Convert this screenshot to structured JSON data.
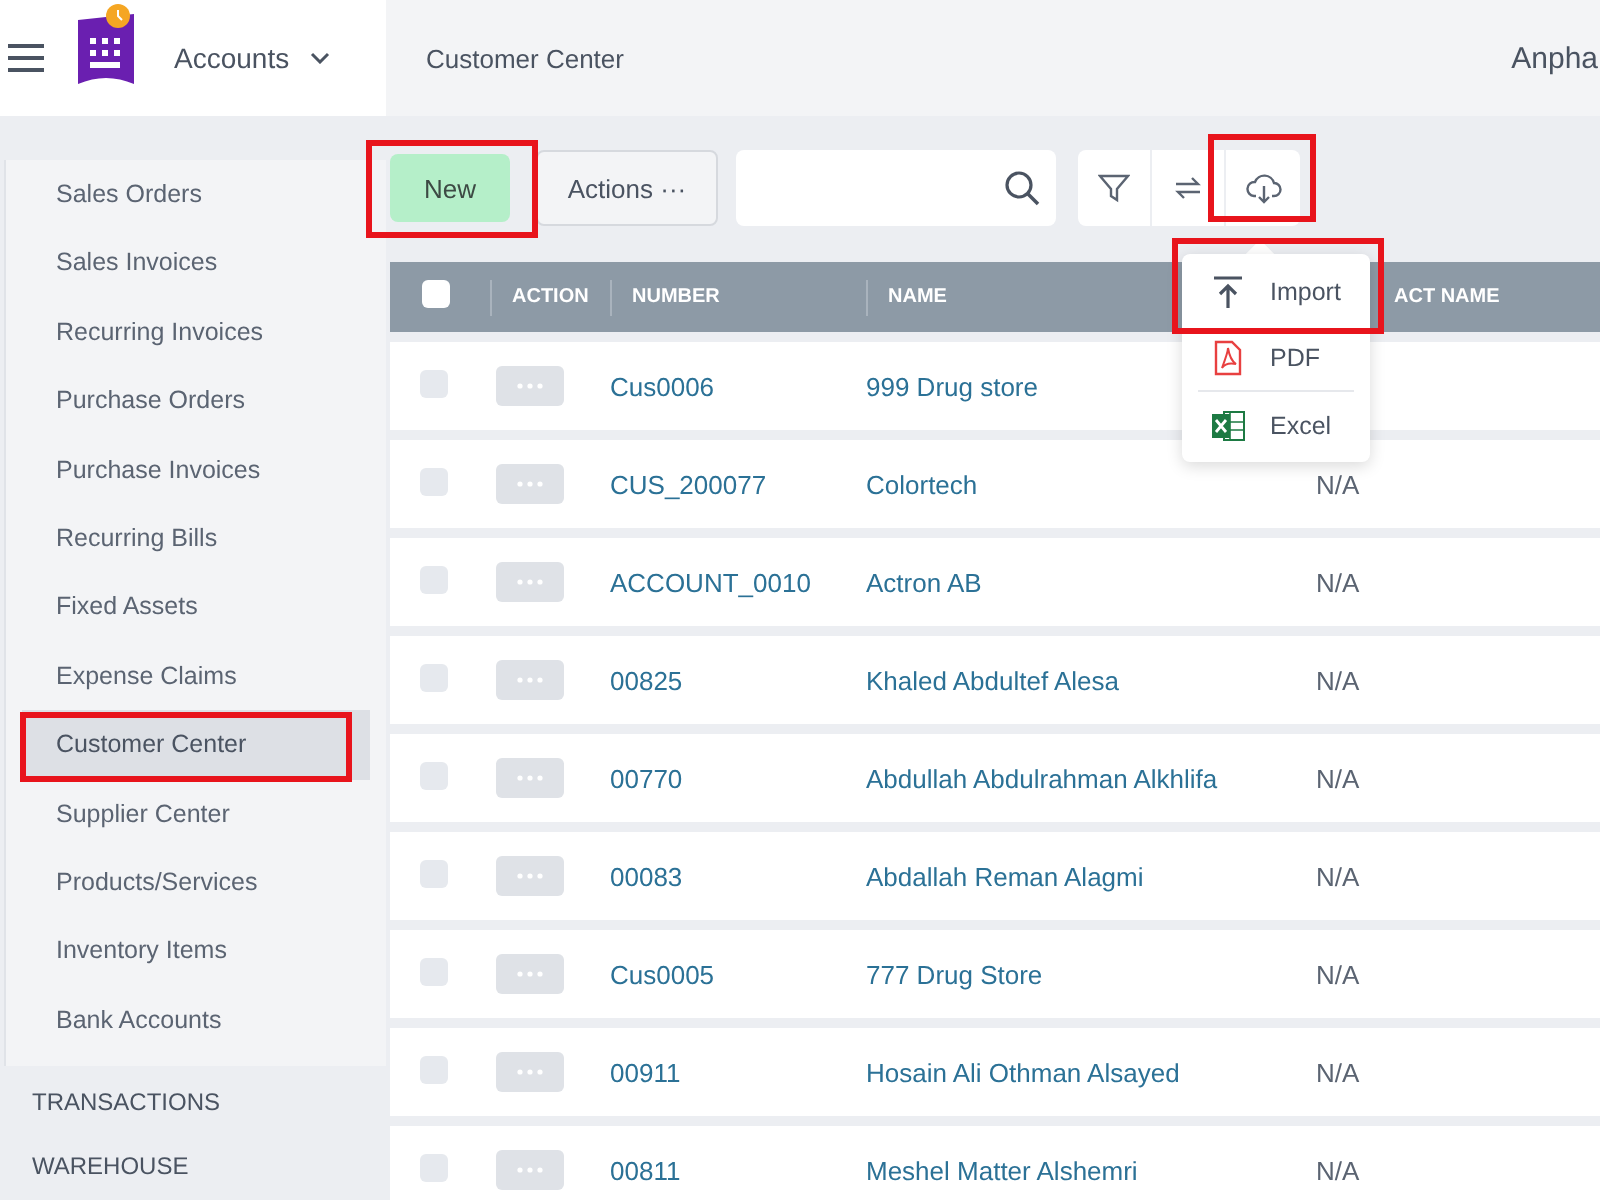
{
  "app": {
    "module": "Accounts",
    "page_title": "Customer Center",
    "company": "Anpha"
  },
  "sidebar": {
    "items": [
      {
        "label": "Sales Orders",
        "selected": false
      },
      {
        "label": "Sales Invoices",
        "selected": false
      },
      {
        "label": "Recurring Invoices",
        "selected": false
      },
      {
        "label": "Purchase Orders",
        "selected": false
      },
      {
        "label": "Purchase Invoices",
        "selected": false
      },
      {
        "label": "Recurring Bills",
        "selected": false
      },
      {
        "label": "Fixed Assets",
        "selected": false
      },
      {
        "label": "Expense Claims",
        "selected": false
      },
      {
        "label": "Customer Center",
        "selected": true
      },
      {
        "label": "Supplier Center",
        "selected": false
      },
      {
        "label": "Products/Services",
        "selected": false
      },
      {
        "label": "Inventory Items",
        "selected": false
      },
      {
        "label": "Bank Accounts",
        "selected": false
      }
    ],
    "sections": [
      "TRANSACTIONS",
      "WAREHOUSE"
    ]
  },
  "toolbar": {
    "new_button": "New",
    "actions_button": "Actions ···"
  },
  "export_menu": {
    "items": [
      {
        "label": "Import",
        "kind": "import"
      },
      {
        "label": "PDF",
        "kind": "pdf"
      },
      {
        "label": "Excel",
        "kind": "excel"
      }
    ]
  },
  "table": {
    "select_all_checked": false,
    "columns": [
      "ACTION",
      "NUMBER",
      "NAME",
      "ACT NAME"
    ],
    "rows": [
      {
        "checked": false,
        "number": "Cus0006",
        "name": "999 Drug store"
      },
      {
        "checked": false,
        "number": "CUS_200077",
        "name": "Colortech",
        "contact": "N/A"
      },
      {
        "checked": false,
        "number": "ACCOUNT_0010",
        "name": "Actron AB",
        "contact": "N/A"
      },
      {
        "checked": false,
        "number": "00825",
        "name": "Khaled Abdultef Alesa",
        "contact": "N/A"
      },
      {
        "checked": false,
        "number": "00770",
        "name": "Abdullah Abdulrahman Alkhlifa",
        "contact": "N/A"
      },
      {
        "checked": false,
        "number": "00083",
        "name": "Abdallah Reman Alagmi",
        "contact": "N/A"
      },
      {
        "checked": false,
        "number": "Cus0005",
        "name": "777 Drug Store",
        "contact": "N/A"
      },
      {
        "checked": false,
        "number": "00911",
        "name": "Hosain Ali Othman Alsayed",
        "contact": "N/A"
      },
      {
        "checked": false,
        "number": "00811",
        "name": "Meshel Matter Alshemri",
        "contact": "N/A"
      }
    ]
  }
}
